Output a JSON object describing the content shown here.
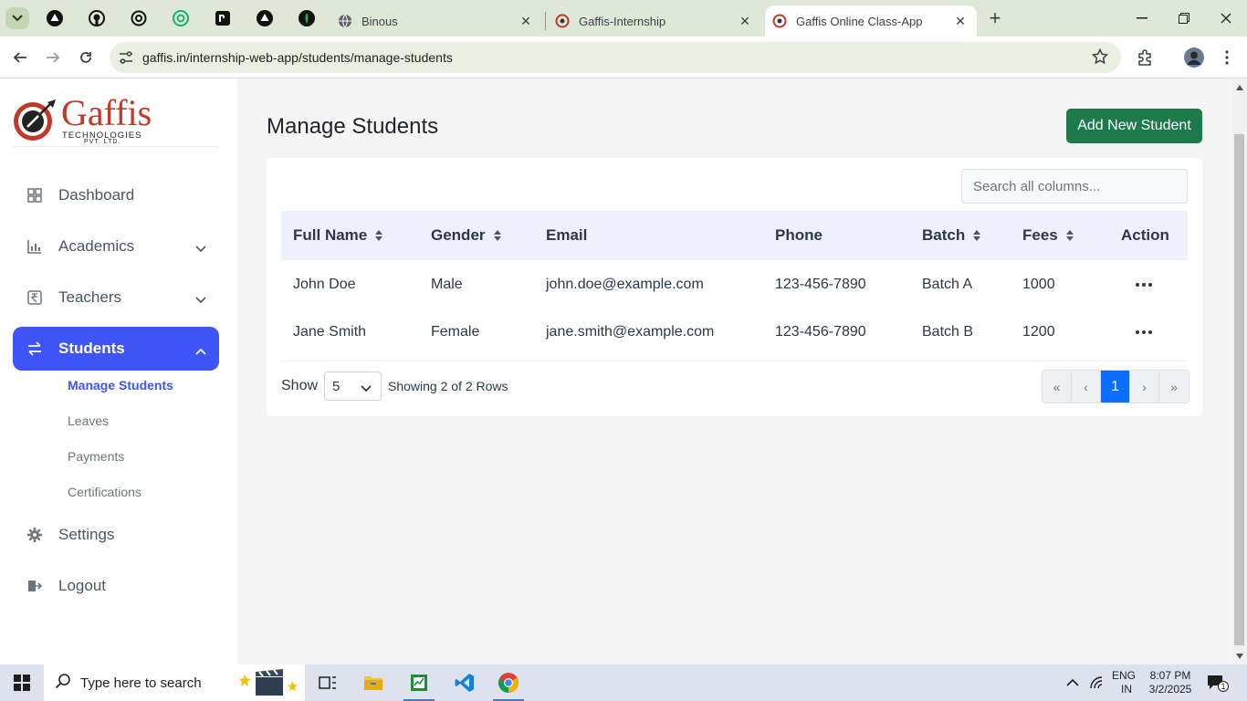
{
  "browser": {
    "tabs": [
      {
        "title": "Binous",
        "active": false
      },
      {
        "title": "Gaffis-Internship",
        "active": false
      },
      {
        "title": "Gaffis Online Class-App",
        "active": true
      }
    ],
    "url": "gaffis.in/internship-web-app/students/manage-students"
  },
  "logo": {
    "name": "Gaffis",
    "tagline": "TECHNOLOGIES",
    "suffix": "PVT. LTD."
  },
  "sidebar": {
    "items": [
      {
        "label": "Dashboard",
        "icon": "grid-icon"
      },
      {
        "label": "Academics",
        "icon": "bar-chart-icon"
      },
      {
        "label": "Teachers",
        "icon": "rupee-icon"
      },
      {
        "label": "Students",
        "icon": "swap-icon"
      },
      {
        "label": "Settings",
        "icon": "gear-icon"
      },
      {
        "label": "Logout",
        "icon": "logout-icon"
      }
    ],
    "students_sub": [
      "Manage Students",
      "Leaves",
      "Payments",
      "Certifications"
    ]
  },
  "main": {
    "title": "Manage Students",
    "add_button": "Add New Student",
    "search_placeholder": "Search all columns...",
    "columns": [
      "Full Name",
      "Gender",
      "Email",
      "Phone",
      "Batch",
      "Fees",
      "Action"
    ],
    "rows": [
      {
        "name": "John Doe",
        "gender": "Male",
        "email": "john.doe@example.com",
        "phone": "123-456-7890",
        "batch": "Batch A",
        "fees": "1000"
      },
      {
        "name": "Jane Smith",
        "gender": "Female",
        "email": "jane.smith@example.com",
        "phone": "123-456-7890",
        "batch": "Batch B",
        "fees": "1200"
      }
    ],
    "show_label": "Show",
    "page_size": "5",
    "rows_info": "Showing 2 of 2 Rows",
    "pager": [
      "«",
      "‹",
      "1",
      "›",
      "»"
    ]
  },
  "taskbar": {
    "search_placeholder": "Type here to search",
    "lang": "ENG",
    "region": "IN",
    "time": "8:07 PM",
    "date": "3/2/2025",
    "notification_count": "1"
  },
  "colors": {
    "primary": "#3e54f5",
    "success": "#1d7b4b",
    "page_active": "#0d6efd"
  }
}
